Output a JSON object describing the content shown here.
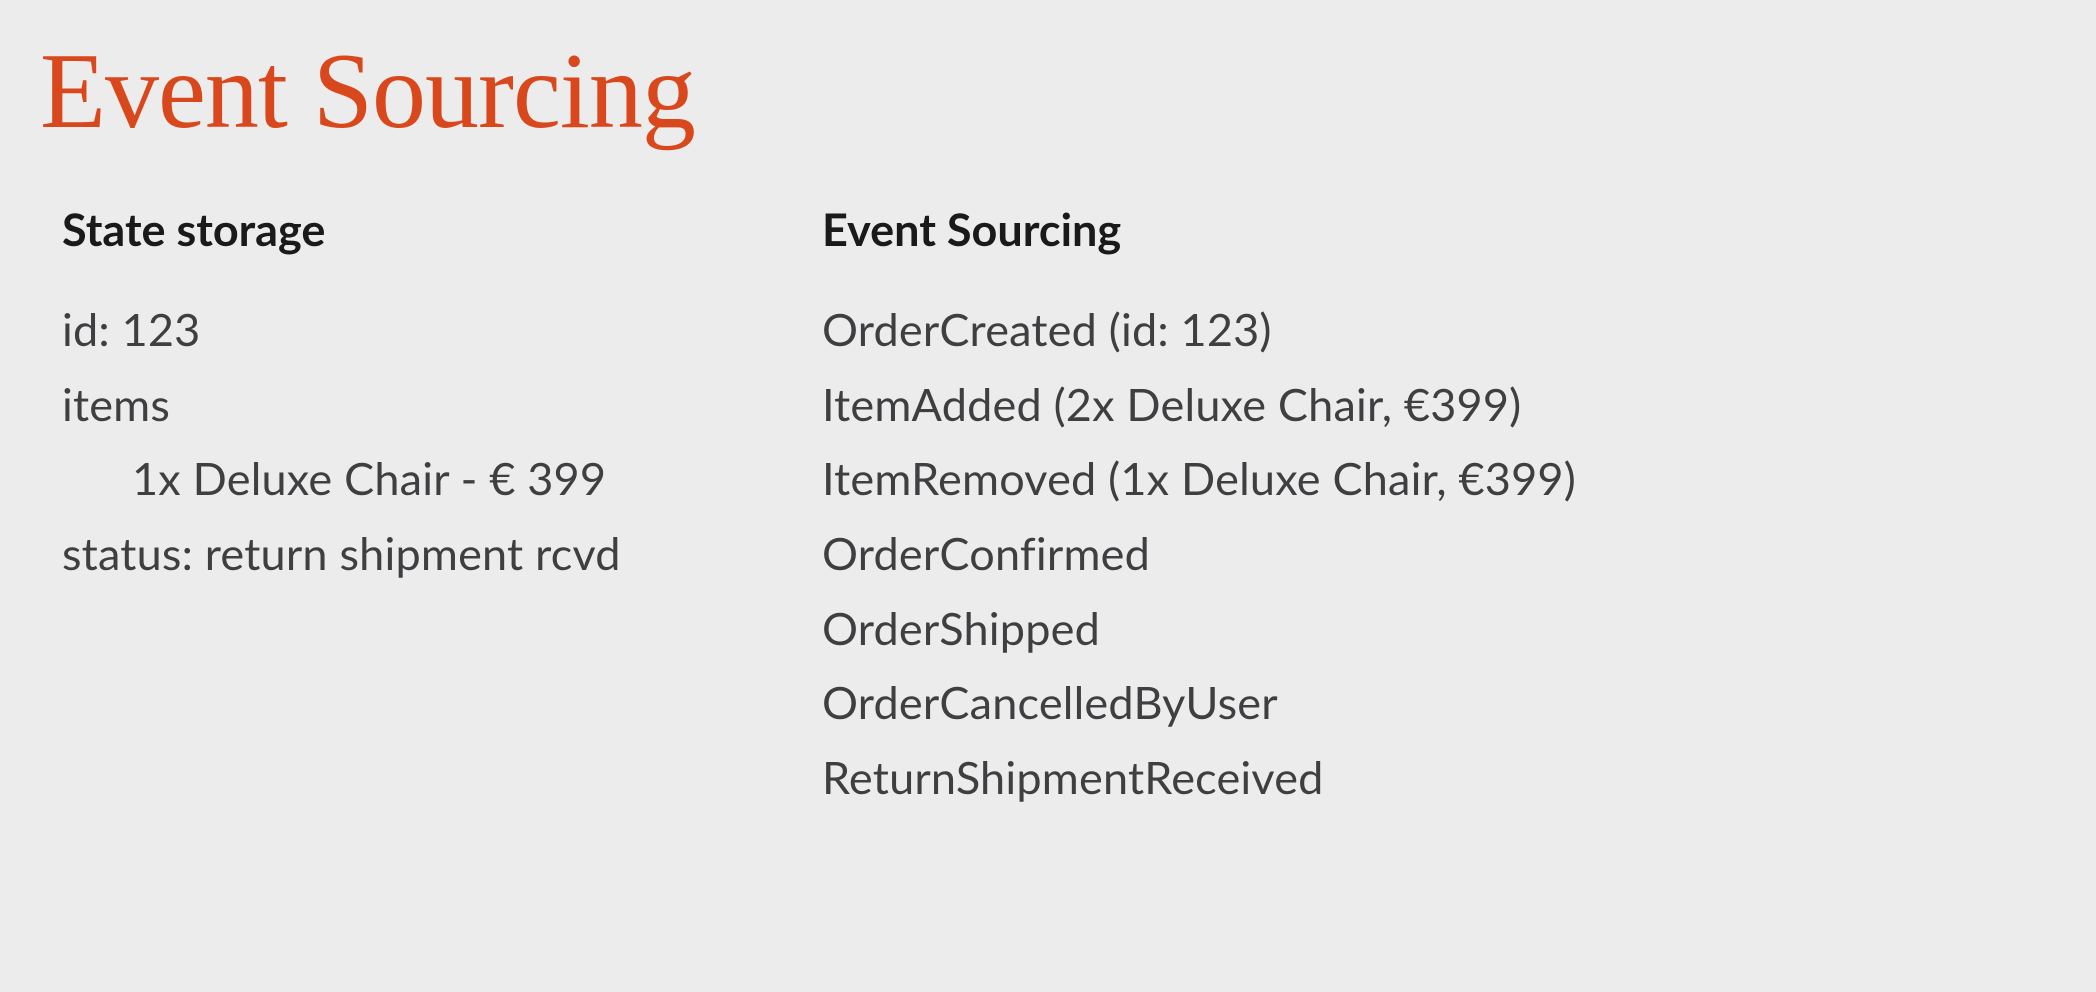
{
  "title": "Event Sourcing",
  "left": {
    "heading": "State storage",
    "lines": [
      "id: 123",
      "items",
      "1x Deluxe Chair - € 399",
      "status: return shipment rcvd"
    ]
  },
  "right": {
    "heading": "Event Sourcing",
    "lines": [
      "OrderCreated (id: 123)",
      "ItemAdded (2x Deluxe Chair, €399)",
      "ItemRemoved (1x Deluxe Chair, €399)",
      "OrderConfirmed",
      "OrderShipped",
      "OrderCancelledByUser",
      "ReturnShipmentReceived"
    ]
  }
}
